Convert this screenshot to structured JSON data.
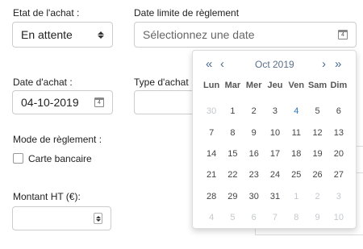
{
  "form": {
    "etat_label": "Etat de l'achat :",
    "etat_value": "En attente",
    "date_limite_label": "Date limite de règlement",
    "date_limite_placeholder": "Sélectionnez une date",
    "date_achat_label": "Date d'achat :",
    "date_achat_value": "04-10-2019",
    "type_achat_label": "Type d'achat",
    "mode_reglement_label": "Mode de règlement :",
    "carte_label": "Carte bancaire",
    "montant_label": "Montant HT (€):"
  },
  "calendar": {
    "month_label": "Oct 2019",
    "prev_year": "«",
    "prev_month": "‹",
    "next_month": "›",
    "next_year": "»",
    "weekdays": [
      "Lun",
      "Mar",
      "Mer",
      "Jeu",
      "Ven",
      "Sam",
      "Dim"
    ],
    "days": [
      {
        "d": "30",
        "s": "muted"
      },
      {
        "d": "1",
        "s": ""
      },
      {
        "d": "2",
        "s": ""
      },
      {
        "d": "3",
        "s": ""
      },
      {
        "d": "4",
        "s": "today"
      },
      {
        "d": "5",
        "s": ""
      },
      {
        "d": "6",
        "s": ""
      },
      {
        "d": "7",
        "s": ""
      },
      {
        "d": "8",
        "s": ""
      },
      {
        "d": "9",
        "s": ""
      },
      {
        "d": "10",
        "s": ""
      },
      {
        "d": "11",
        "s": ""
      },
      {
        "d": "12",
        "s": ""
      },
      {
        "d": "13",
        "s": ""
      },
      {
        "d": "14",
        "s": ""
      },
      {
        "d": "15",
        "s": ""
      },
      {
        "d": "16",
        "s": ""
      },
      {
        "d": "17",
        "s": ""
      },
      {
        "d": "18",
        "s": ""
      },
      {
        "d": "19",
        "s": ""
      },
      {
        "d": "20",
        "s": ""
      },
      {
        "d": "21",
        "s": ""
      },
      {
        "d": "22",
        "s": ""
      },
      {
        "d": "23",
        "s": ""
      },
      {
        "d": "24",
        "s": ""
      },
      {
        "d": "25",
        "s": ""
      },
      {
        "d": "26",
        "s": ""
      },
      {
        "d": "27",
        "s": ""
      },
      {
        "d": "28",
        "s": ""
      },
      {
        "d": "29",
        "s": ""
      },
      {
        "d": "30",
        "s": ""
      },
      {
        "d": "31",
        "s": ""
      },
      {
        "d": "1",
        "s": "muted"
      },
      {
        "d": "2",
        "s": "muted"
      },
      {
        "d": "3",
        "s": "muted"
      },
      {
        "d": "4",
        "s": "muted"
      },
      {
        "d": "5",
        "s": "muted"
      },
      {
        "d": "6",
        "s": "muted"
      },
      {
        "d": "7",
        "s": "muted"
      },
      {
        "d": "8",
        "s": "muted"
      },
      {
        "d": "9",
        "s": "muted"
      },
      {
        "d": "10",
        "s": "muted"
      }
    ]
  },
  "icons": {
    "calendar_day": "4"
  }
}
